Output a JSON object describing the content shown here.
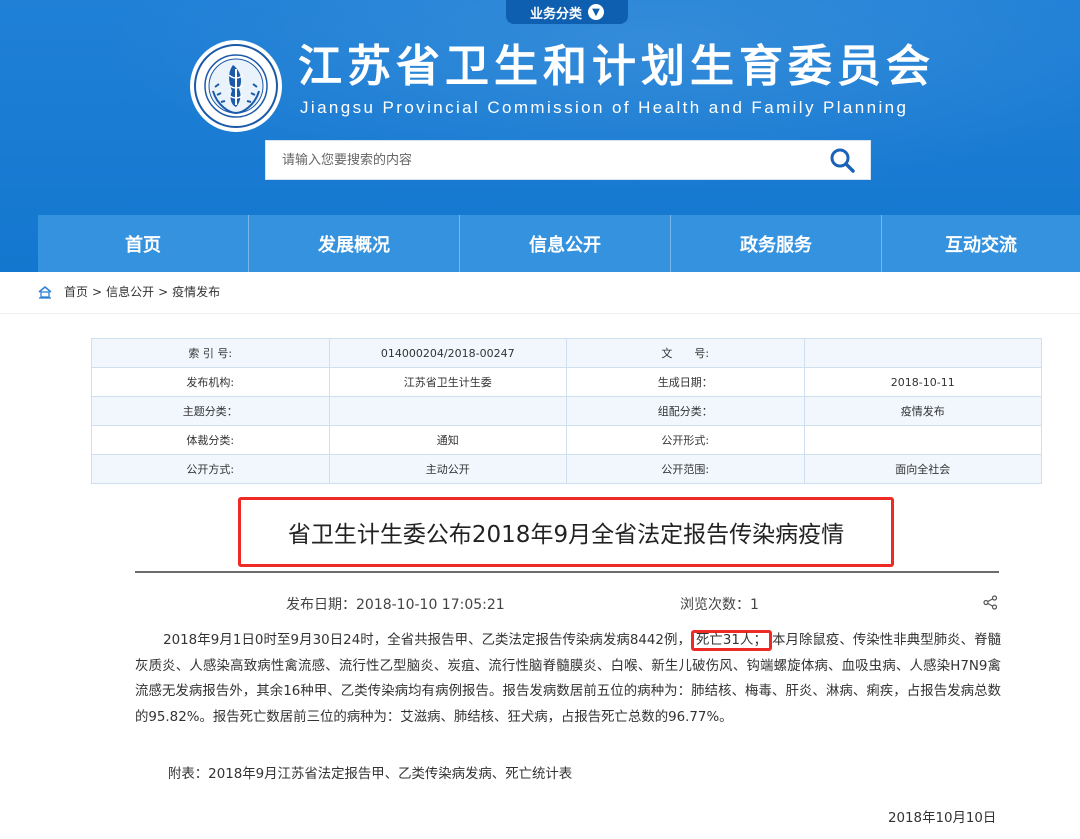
{
  "header": {
    "biz_tab_label": "业务分类",
    "title": "江苏省卫生和计划生育委员会",
    "subtitle": "Jiangsu Provincial Commission of Health and Family Planning",
    "search_placeholder": "请输入您要搜索的内容"
  },
  "nav": {
    "items": [
      {
        "label": "首页"
      },
      {
        "label": "发展概况"
      },
      {
        "label": "信息公开"
      },
      {
        "label": "政务服务"
      },
      {
        "label": "互动交流"
      }
    ]
  },
  "breadcrumb": {
    "home": "首页",
    "sep": ">",
    "info": "信息公开",
    "current": "疫情发布"
  },
  "info_table": {
    "rows": [
      [
        {
          "k": "索 引 号:",
          "v": "014000204/2018-00247"
        },
        {
          "k": "文　　号:",
          "v": ""
        }
      ],
      [
        {
          "k": "发布机构:",
          "v": "江苏省卫生计生委"
        },
        {
          "k": "生成日期：",
          "v": "2018-10-11"
        }
      ],
      [
        {
          "k": "主题分类：",
          "v": ""
        },
        {
          "k": "组配分类：",
          "v": "疫情发布"
        }
      ],
      [
        {
          "k": "体裁分类:",
          "v": "通知"
        },
        {
          "k": "公开形式:",
          "v": ""
        }
      ],
      [
        {
          "k": "公开方式:",
          "v": "主动公开"
        },
        {
          "k": "公开范围:",
          "v": "面向全社会"
        }
      ]
    ]
  },
  "article": {
    "title": "省卫生计生委公布2018年9月全省法定报告传染病疫情",
    "publish_date": "发布日期：2018-10-10 17:05:21",
    "views": "浏览次数：1",
    "body_before": "2018年9月1日0时至9月30日24时，全省共报告甲、乙类法定报告传染病发病8442例，",
    "body_highlight": "死亡31人；",
    "body_after": "本月除鼠疫、传染性非典型肺炎、脊髓灰质炎、人感染高致病性禽流感、流行性乙型脑炎、炭疽、流行性脑脊髓膜炎、白喉、新生儿破伤风、钩端螺旋体病、血吸虫病、人感染H7N9禽流感无发病报告外，其余16种甲、乙类传染病均有病例报告。报告发病数居前五位的病种为：肺结核、梅毒、肝炎、淋病、痢疾，占报告发病总数的95.82%。报告死亡数居前三位的病种为：艾滋病、肺结核、狂犬病，占报告死亡总数的96.77%。",
    "attachment": "附表：2018年9月江苏省法定报告甲、乙类传染病发病、死亡统计表",
    "sign_date": "2018年10月10日"
  },
  "colors": {
    "header_blue": "#1477cf",
    "nav_blue": "#3592df",
    "highlight_red": "#ee2a24",
    "table_border": "#cfdff0"
  }
}
